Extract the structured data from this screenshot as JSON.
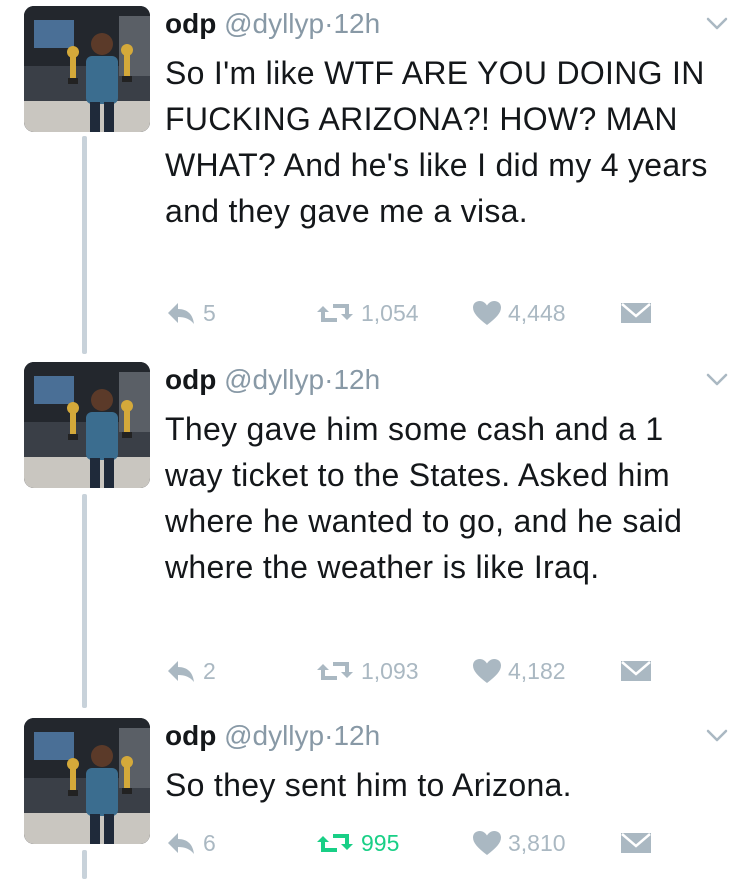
{
  "colors": {
    "text": "#14171a",
    "muted": "#8899a6",
    "action": "#aab8c2",
    "retweet_active": "#19cf86",
    "thread_line": "#c8d2da"
  },
  "tweets": [
    {
      "name": "odp",
      "handle": "@dyllyp",
      "dot": "·",
      "time": "12h",
      "text": "So I'm like WTF ARE YOU DOING IN FUCKING ARIZONA?! HOW? MAN WHAT? And he's like I did my 4 years and they gave me a visa.",
      "replies": "5",
      "retweets": "1,054",
      "likes": "4,448",
      "icons": [
        "reply-icon",
        "retweet-icon",
        "heart-icon",
        "envelope-icon",
        "chevron-down-icon"
      ]
    },
    {
      "name": "odp",
      "handle": "@dyllyp",
      "dot": "·",
      "time": "12h",
      "text": "They gave him some cash and a 1 way ticket to the States. Asked him where he wanted to go, and he said where the weather is like Iraq.",
      "replies": "2",
      "retweets": "1,093",
      "likes": "4,182",
      "icons": [
        "reply-icon",
        "retweet-icon",
        "heart-icon",
        "envelope-icon",
        "chevron-down-icon"
      ]
    },
    {
      "name": "odp",
      "handle": "@dyllyp",
      "dot": "·",
      "time": "12h",
      "text": "So they sent him to Arizona.",
      "replies": "6",
      "retweets": "995",
      "retweeted": true,
      "likes": "3,810",
      "icons": [
        "reply-icon",
        "retweet-icon",
        "heart-icon",
        "envelope-icon",
        "chevron-down-icon"
      ]
    }
  ]
}
